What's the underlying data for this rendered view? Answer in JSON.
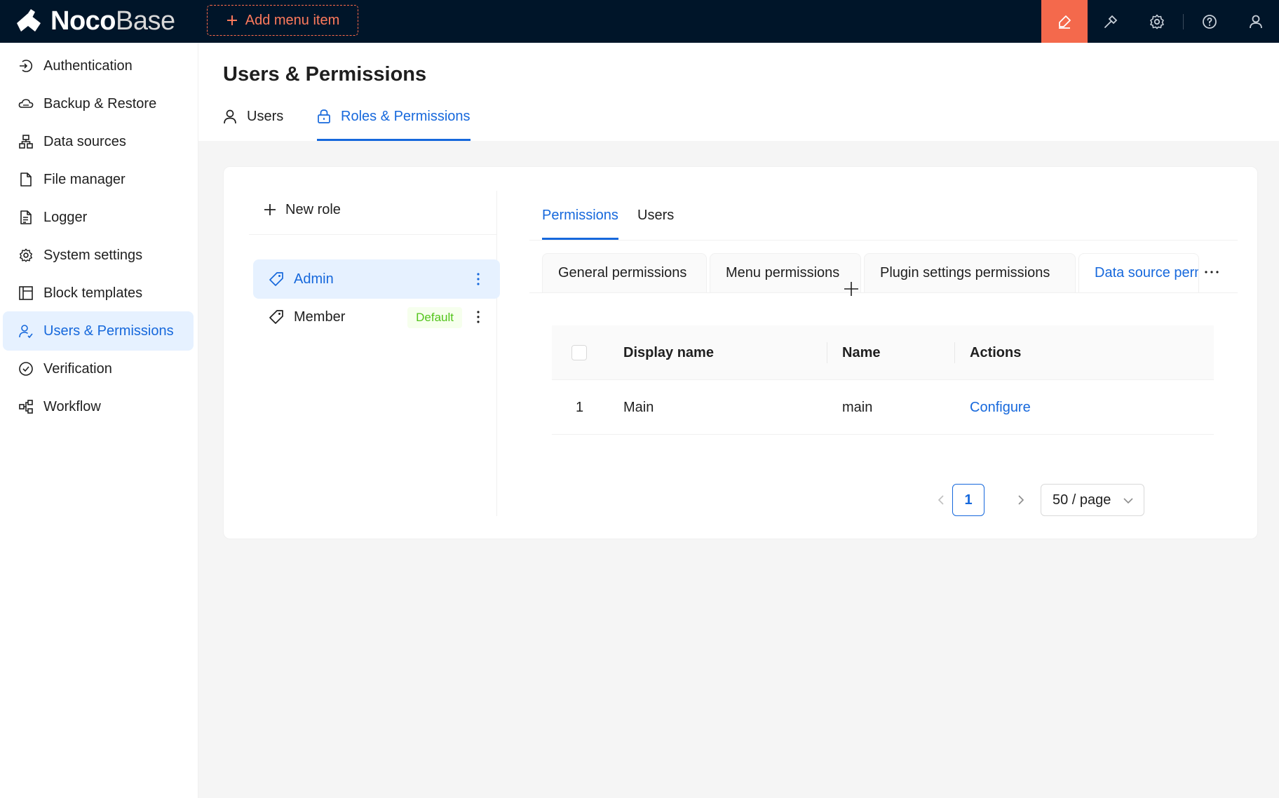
{
  "app": {
    "logo_bold": "Noco",
    "logo_light": "Base",
    "add_menu_label": "Add menu item"
  },
  "topbar_icons": [
    "highlighter-icon",
    "plugin-icon",
    "gear-icon",
    "help-icon",
    "user-icon"
  ],
  "sidebar": {
    "items": [
      {
        "label": "Authentication",
        "icon": "login-icon"
      },
      {
        "label": "Backup & Restore",
        "icon": "cloud-icon"
      },
      {
        "label": "Data sources",
        "icon": "database-icon"
      },
      {
        "label": "File manager",
        "icon": "file-icon"
      },
      {
        "label": "Logger",
        "icon": "log-file-icon"
      },
      {
        "label": "System settings",
        "icon": "gear-icon"
      },
      {
        "label": "Block templates",
        "icon": "layout-icon"
      },
      {
        "label": "Users & Permissions",
        "icon": "users-icon",
        "active": true
      },
      {
        "label": "Verification",
        "icon": "check-circle-icon"
      },
      {
        "label": "Workflow",
        "icon": "workflow-icon"
      }
    ]
  },
  "page": {
    "title": "Users & Permissions",
    "tabs": [
      {
        "label": "Users",
        "icon": "user-icon"
      },
      {
        "label": "Roles & Permissions",
        "icon": "lock-icon",
        "active": true
      }
    ]
  },
  "roles": {
    "new_role_label": "New role",
    "items": [
      {
        "label": "Admin",
        "active": true
      },
      {
        "label": "Member",
        "badge": "Default"
      }
    ]
  },
  "permissions": {
    "sub_tabs": [
      {
        "label": "Permissions",
        "active": true
      },
      {
        "label": "Users"
      }
    ],
    "card_tabs": [
      {
        "label": "General permissions"
      },
      {
        "label": "Menu permissions"
      },
      {
        "label": "Plugin settings permissions"
      },
      {
        "label": "Data source permissions",
        "active": true
      }
    ],
    "table": {
      "columns": [
        "Display name",
        "Name",
        "Actions"
      ],
      "rows": [
        {
          "index": "1",
          "display_name": "Main",
          "name": "main",
          "action": "Configure"
        }
      ]
    },
    "pagination": {
      "current_page": "1",
      "page_size": "50 / page"
    }
  },
  "colors": {
    "topbar": "#001529",
    "accent": "#1668dc",
    "highlight": "#f4694c",
    "default_badge": "#52c41a"
  }
}
